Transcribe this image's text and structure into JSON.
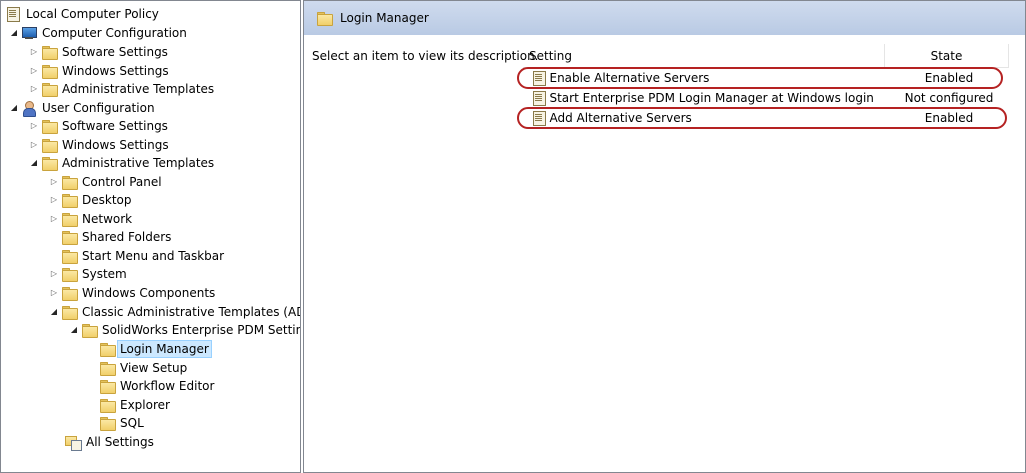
{
  "tree": {
    "root": "Local Computer Policy",
    "computer_configuration": {
      "label": "Computer Configuration",
      "children": [
        "Software Settings",
        "Windows Settings",
        "Administrative Templates"
      ]
    },
    "user_configuration": {
      "label": "User Configuration",
      "software_settings": "Software Settings",
      "windows_settings": "Windows Settings",
      "administrative_templates": {
        "label": "Administrative Templates",
        "children": [
          "Control Panel",
          "Desktop",
          "Network",
          "Shared Folders",
          "Start Menu and Taskbar",
          "System",
          "Windows Components"
        ],
        "classic": {
          "label": "Classic Administrative Templates (ADM",
          "solidworks": {
            "label": "SolidWorks Enterprise PDM Settings",
            "children": [
              "Login Manager",
              "View Setup",
              "Workflow Editor",
              "Explorer",
              "SQL"
            ]
          }
        }
      },
      "all_settings": "All Settings"
    }
  },
  "details": {
    "header_title": "Login Manager",
    "description": "Select an item to view its description.",
    "columns": {
      "setting": "Setting",
      "state": "State"
    },
    "rows": [
      {
        "setting": "Enable Alternative Servers",
        "state": "Enabled"
      },
      {
        "setting": "Start Enterprise PDM Login Manager at Windows login",
        "state": "Not configured"
      },
      {
        "setting": "Add Alternative Servers",
        "state": "Enabled"
      }
    ],
    "highlighted_rows": [
      "Enable Alternative Servers",
      "Add Alternative Servers"
    ],
    "highlight_color": "#b52222",
    "selected_tree_item": "Login Manager"
  }
}
